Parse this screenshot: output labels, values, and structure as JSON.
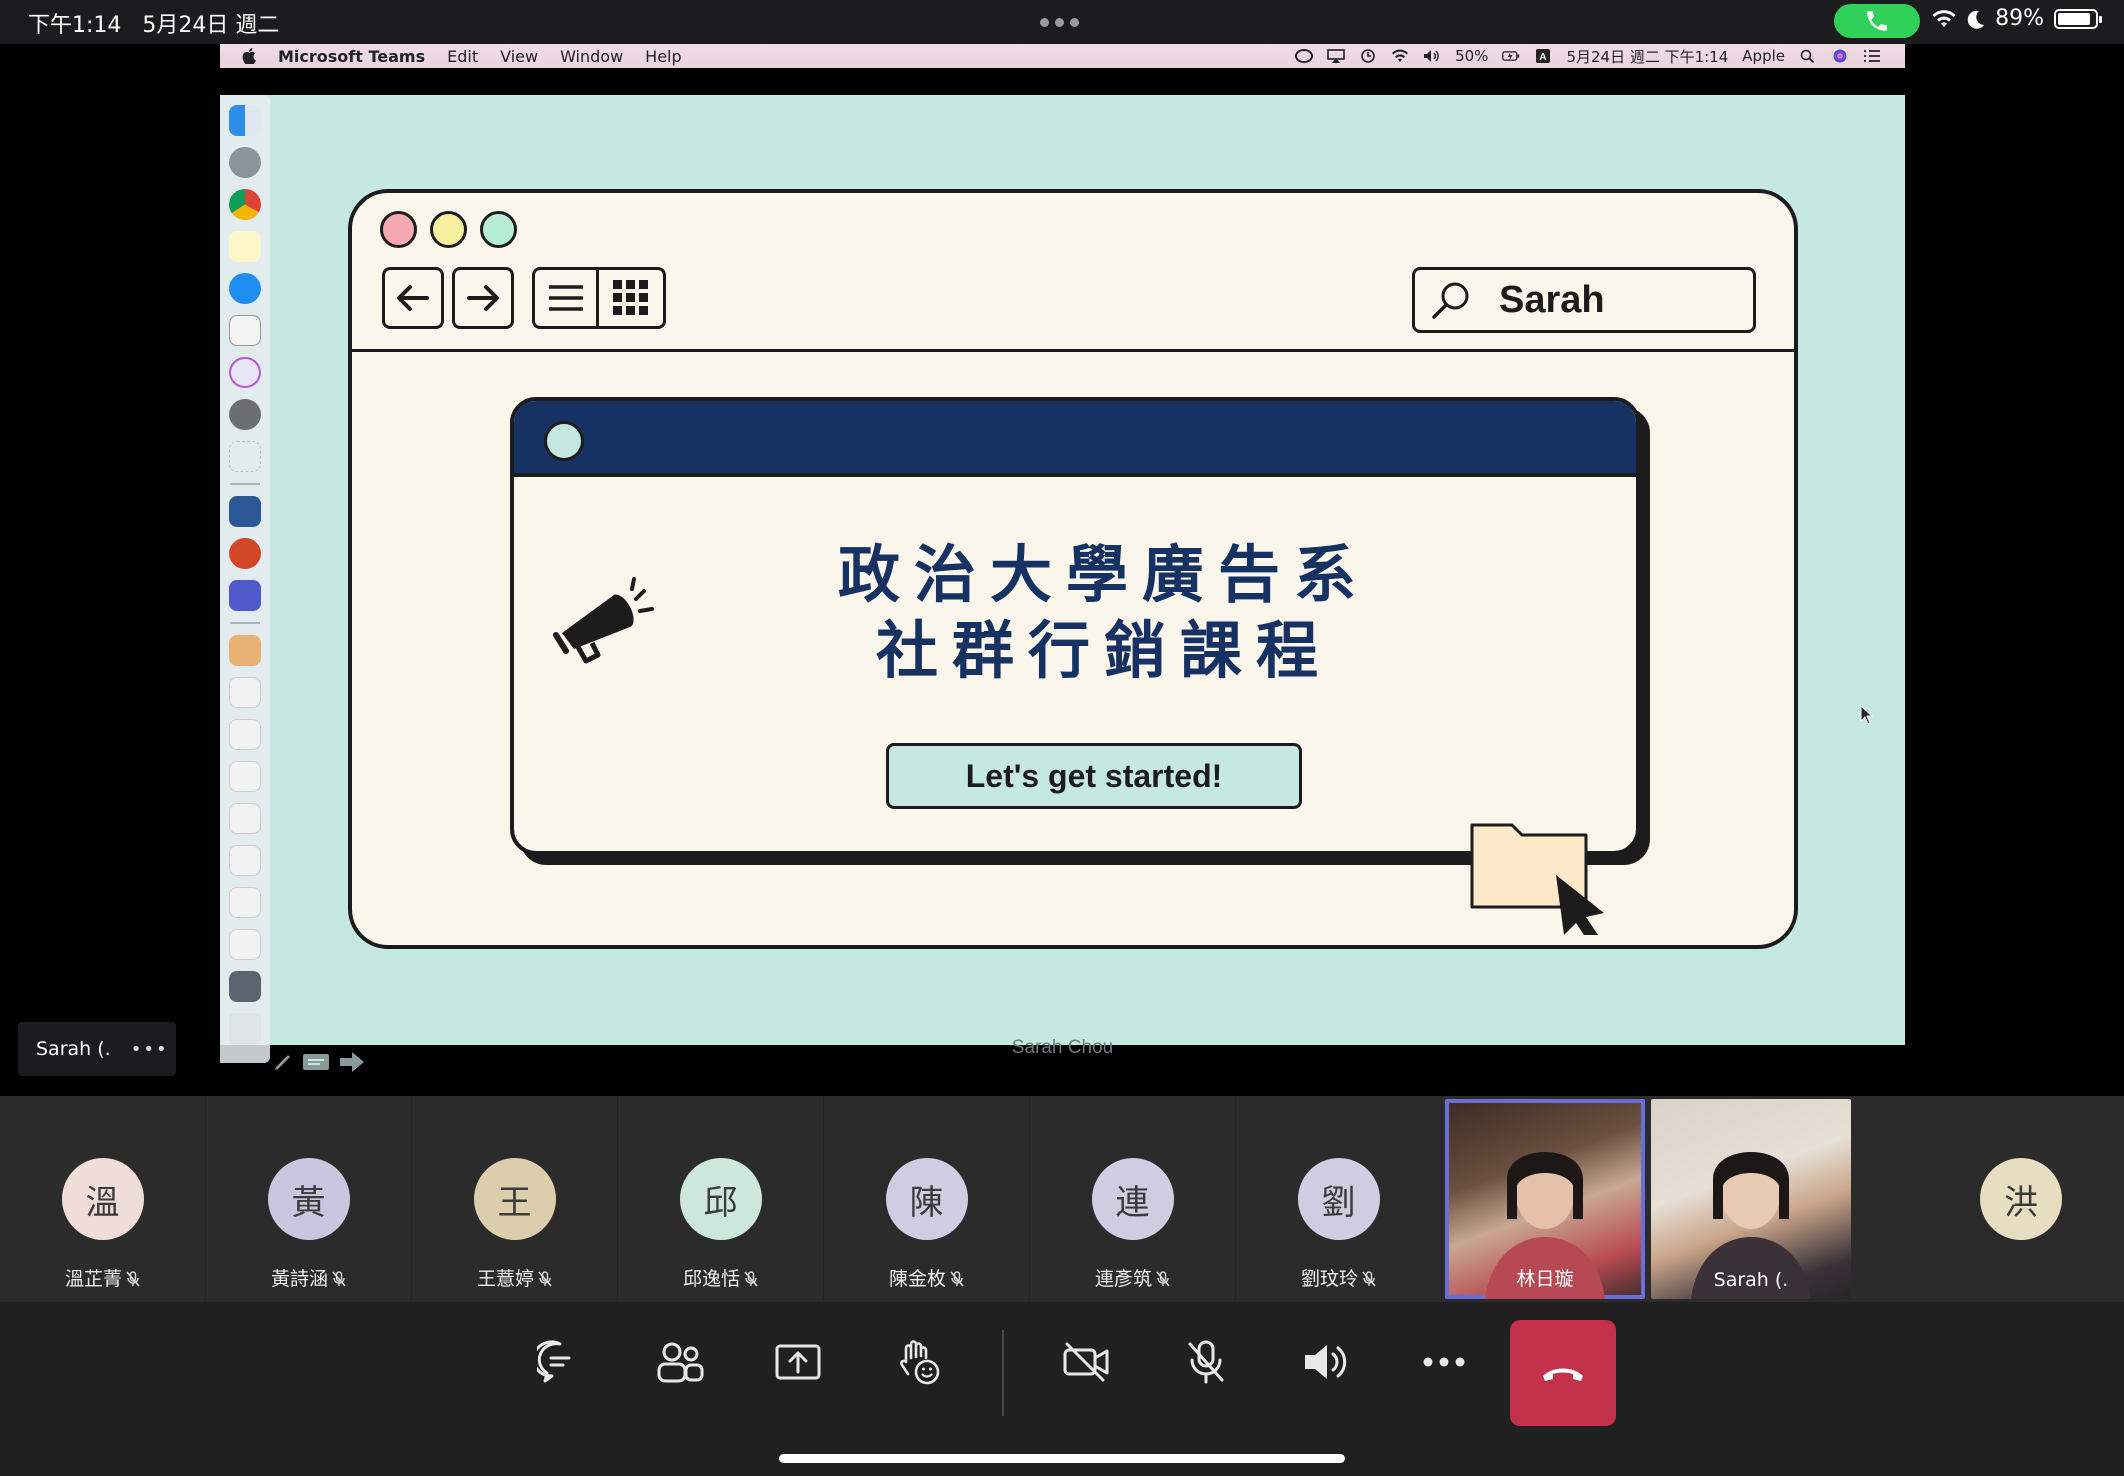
{
  "status_bar": {
    "time": "下午1:14",
    "date": "5月24日 週二",
    "battery": "89%",
    "battery_level": 0.89
  },
  "mac_menu": {
    "app_name": "Microsoft Teams",
    "menus": [
      "Edit",
      "View",
      "Window",
      "Help"
    ],
    "battery": "50%",
    "datetime": "5月24日 週二 下午1:14",
    "user": "Apple"
  },
  "slide": {
    "search_text": "Sarah",
    "title_line1": "政治大學廣告系",
    "title_line2": "社群行銷課程",
    "button_label": "Let's get started!",
    "footer": "Sarah Chou"
  },
  "presenter_tag": {
    "name": "Sarah (.",
    "more": "•••"
  },
  "participants": [
    {
      "initial": "溫",
      "name": "溫芷菁",
      "color": "#f0ddd7"
    },
    {
      "initial": "黃",
      "name": "黃詩涵",
      "color": "#c9c6df"
    },
    {
      "initial": "王",
      "name": "王薏婷",
      "color": "#dccdac"
    },
    {
      "initial": "邱",
      "name": "邱逸恬",
      "color": "#cde8da"
    },
    {
      "initial": "陳",
      "name": "陳金枚",
      "color": "#cfcde2"
    },
    {
      "initial": "連",
      "name": "連彥筑",
      "color": "#cfcde2"
    },
    {
      "initial": "劉",
      "name": "劉玟玲",
      "color": "#cfcde2"
    }
  ],
  "video_participants": [
    {
      "name": "林日璇"
    },
    {
      "name": "Sarah (."
    }
  ],
  "last_participant": {
    "initial": "洪",
    "color": "#e7ddc0"
  },
  "colors": {
    "slide_bg": "#c5e9e1",
    "navy": "#163262",
    "hangup": "#c4314b",
    "active_speaker": "#6a6fd6"
  }
}
